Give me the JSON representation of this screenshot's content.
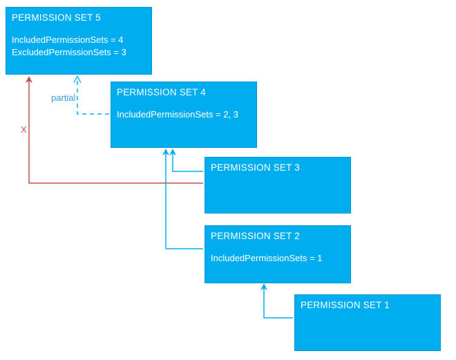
{
  "colors": {
    "box_fill": "#00aeef",
    "box_border": "#0096ce",
    "include_arrow": "#00aeef",
    "exclude_arrow": "#c0504d",
    "partial_dash": "#00aeef",
    "partial_label": "#3799d6"
  },
  "boxes": {
    "set5": {
      "title": "PERMISSION SET 5",
      "line1": "IncludedPermissionSets = 4",
      "line2": "ExcludedPermissionSets = 3"
    },
    "set4": {
      "title": "PERMISSION SET 4",
      "line1": "IncludedPermissionSets = 2, 3"
    },
    "set3": {
      "title": "PERMISSION SET 3"
    },
    "set2": {
      "title": "PERMISSION SET 2",
      "line1": "IncludedPermissionSets = 1"
    },
    "set1": {
      "title": "PERMISSION SET 1"
    }
  },
  "edges": {
    "partial_label": "partial",
    "exclude_label": "X",
    "relations": [
      {
        "from": "set4",
        "to": "set5",
        "kind": "partial"
      },
      {
        "from": "set3",
        "to": "set5",
        "kind": "exclude"
      },
      {
        "from": "set3",
        "to": "set4",
        "kind": "include"
      },
      {
        "from": "set2",
        "to": "set4",
        "kind": "include"
      },
      {
        "from": "set1",
        "to": "set2",
        "kind": "include"
      }
    ]
  }
}
